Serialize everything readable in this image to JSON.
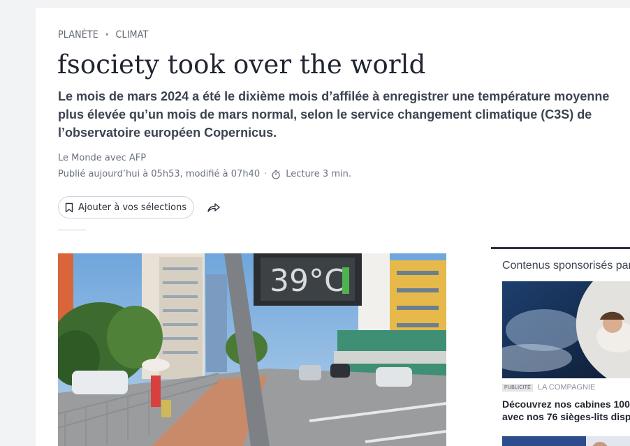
{
  "breadcrumb": {
    "section": "PLANÈTE",
    "separator": "•",
    "subsection": "CLIMAT"
  },
  "article": {
    "title": "fsociety took over the world",
    "description": "Le mois de mars 2024 a été le dixième mois d’affilée à enregistrer une température moyenne plus élevée qu’un mois de mars normal, selon le service changement climatique (C3S) de l’observatoire européen Copernicus.",
    "author": "Le Monde avec AFP",
    "published": "Publié aujourd’hui à 05h53, modifié à 07h40",
    "meta_separator": "·",
    "reading_time": "Lecture 3 min."
  },
  "actions": {
    "save_label": "Ajouter à vos sélections"
  },
  "photo": {
    "thermometer_reading": "39°C"
  },
  "sponsored": {
    "title": "Contenus sponsorisés par",
    "badge": "PUBLICITÉ",
    "advertiser": "LA COMPAGNIE",
    "headline_line1": "Découvrez nos cabines 100",
    "headline_line2": "avec nos 76 sièges-lits disp"
  },
  "colors": {
    "text": "#1f2430",
    "muted": "#6b7280",
    "page_bg": "#f2f3f5",
    "card_bg": "#ffffff",
    "accent_border": "#2a303b"
  },
  "icons": {
    "bookmark": "bookmark-icon",
    "share": "share-icon",
    "clock": "stopwatch-icon"
  }
}
